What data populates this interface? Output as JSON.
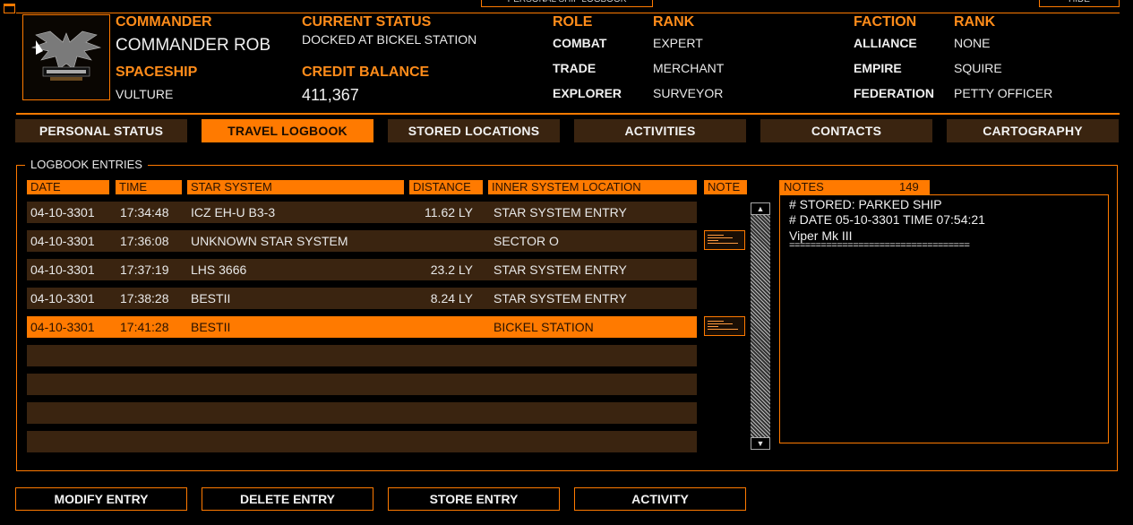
{
  "window": {
    "title": "PERSONAL SHIP LOGBOOK",
    "hide_label": "HIDE"
  },
  "header": {
    "commander_label": "COMMANDER",
    "commander_name": "COMMANDER ROB",
    "spaceship_label": "SPACESHIP",
    "spaceship_name": "VULTURE",
    "status_label": "CURRENT STATUS",
    "status_value": "DOCKED AT BICKEL STATION",
    "credit_label": "CREDIT BALANCE",
    "credit_value": "411,367",
    "role_label": "ROLE",
    "rank_label": "RANK",
    "roles": [
      {
        "role": "COMBAT",
        "rank": "EXPERT"
      },
      {
        "role": "TRADE",
        "rank": "MERCHANT"
      },
      {
        "role": "EXPLORER",
        "rank": "SURVEYOR"
      }
    ],
    "faction_label": "FACTION",
    "faction_rank_label": "RANK",
    "factions": [
      {
        "faction": "ALLIANCE",
        "rank": "NONE"
      },
      {
        "faction": "EMPIRE",
        "rank": "SQUIRE"
      },
      {
        "faction": "FEDERATION",
        "rank": "PETTY OFFICER"
      }
    ]
  },
  "tabs": [
    {
      "label": "PERSONAL STATUS"
    },
    {
      "label": "TRAVEL LOGBOOK"
    },
    {
      "label": "STORED LOCATIONS"
    },
    {
      "label": "ACTIVITIES"
    },
    {
      "label": "CONTACTS"
    },
    {
      "label": "CARTOGRAPHY"
    }
  ],
  "logbook": {
    "title": "LOGBOOK ENTRIES",
    "columns": [
      "DATE",
      "TIME",
      "STAR SYSTEM",
      "DISTANCE",
      "INNER SYSTEM LOCATION",
      "NOTE"
    ],
    "rows": [
      {
        "date": "04-10-3301",
        "time": "17:34:48",
        "system": "ICZ EH-U B3-3",
        "distance": "11.62 LY",
        "location": "STAR SYSTEM ENTRY",
        "has_note": false
      },
      {
        "date": "04-10-3301",
        "time": "17:36:08",
        "system": "UNKNOWN STAR SYSTEM",
        "distance": "",
        "location": "SECTOR O",
        "has_note": true
      },
      {
        "date": "04-10-3301",
        "time": "17:37:19",
        "system": "LHS 3666",
        "distance": "23.2 LY",
        "location": "STAR SYSTEM ENTRY",
        "has_note": false
      },
      {
        "date": "04-10-3301",
        "time": "17:38:28",
        "system": "BESTII",
        "distance": "8.24 LY",
        "location": "STAR SYSTEM ENTRY",
        "has_note": false
      },
      {
        "date": "04-10-3301",
        "time": "17:41:28",
        "system": "BESTII",
        "distance": "",
        "location": "BICKEL STATION",
        "has_note": true
      }
    ]
  },
  "notes": {
    "label": "NOTES",
    "count": "149",
    "lines": [
      "# STORED: PARKED SHIP",
      "# DATE 05-10-3301 TIME 07:54:21",
      "Viper Mk III",
      "=================================="
    ]
  },
  "buttons": {
    "modify": "MODIFY ENTRY",
    "delete": "DELETE ENTRY",
    "store": "STORE ENTRY",
    "activity": "ACTIVITY"
  },
  "colors": {
    "accent": "#ff7a00",
    "row_bg": "#3a2410",
    "background": "#000000"
  }
}
